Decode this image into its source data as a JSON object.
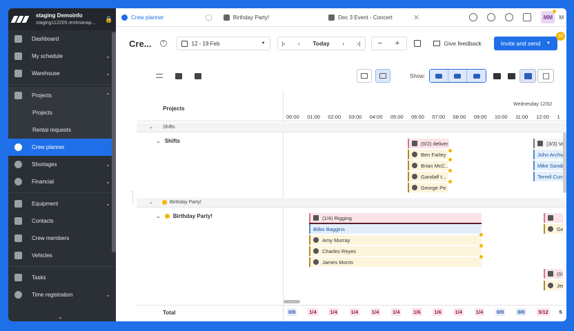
{
  "colors": {
    "brand": "#1f6fe8",
    "sidebar_bg": "#2b2f36",
    "warn": "#f2b705"
  },
  "org": {
    "name": "staging Demoinfo",
    "url": "staging112205.rentmanap..."
  },
  "sidebar": {
    "items": [
      {
        "label": "Dashboard",
        "icon": "grid-icon"
      },
      {
        "label": "My schedule",
        "icon": "calendar-icon"
      },
      {
        "label": "Warehouse",
        "icon": "warehouse-icon"
      },
      {
        "label": "Projects",
        "icon": "projects-icon"
      },
      {
        "label": "Projects",
        "icon": ""
      },
      {
        "label": "Rental requests",
        "icon": ""
      },
      {
        "label": "Crew planner",
        "icon": "person-icon"
      },
      {
        "label": "Shortages",
        "icon": "shortage-icon"
      },
      {
        "label": "Financial",
        "icon": "dollar-icon"
      },
      {
        "label": "Equipment",
        "icon": "equipment-icon"
      },
      {
        "label": "Contacts",
        "icon": "contacts-icon"
      },
      {
        "label": "Crew members",
        "icon": "crew-icon"
      },
      {
        "label": "Vehicles",
        "icon": "truck-icon"
      },
      {
        "label": "Tasks",
        "icon": "tasks-icon"
      },
      {
        "label": "Time registration",
        "icon": "clock-icon"
      }
    ]
  },
  "tabs": [
    {
      "label": "Crew planner"
    },
    {
      "label": "Birthday Party!"
    },
    {
      "label": "Dec 3 Event - Concert"
    }
  ],
  "user": {
    "initials": "MM",
    "name_short": "M"
  },
  "toolbar": {
    "title": "Cre...",
    "date_range": "12 - 19 Feb",
    "today_label": "Today",
    "feedback_label": "Give feedback",
    "invite_label": "Invite and send",
    "notif_count": "28"
  },
  "filters": {
    "show_label": "Show:"
  },
  "grid": {
    "projects_header": "Projects",
    "day_header": "Wednesday 12/02",
    "hours": [
      "00:00",
      "01:00",
      "02:00",
      "03:00",
      "04:00",
      "05:00",
      "06:00",
      "07:00",
      "08:00",
      "09:00",
      "10:00",
      "11:00",
      "12:00",
      "1"
    ],
    "groups": [
      {
        "label": "Shifts",
        "row_label": "Shifts"
      },
      {
        "label": "Birthday Party!",
        "row_label": "Birthday Party!"
      }
    ],
    "shift_cards": [
      {
        "label": "(0/2) deliver",
        "type": "head"
      },
      {
        "label": "Ben Farley",
        "type": "assign"
      },
      {
        "label": "Brian McC...",
        "type": "assign"
      },
      {
        "label": "Gandalf t...",
        "type": "assign"
      },
      {
        "label": "George Pe...",
        "type": "assign"
      }
    ],
    "shift_cards_right": [
      {
        "label": "(3/3) Va",
        "type": "head2"
      },
      {
        "label": "John Archu",
        "type": "person"
      },
      {
        "label": "Mike Sande",
        "type": "person"
      },
      {
        "label": "Terrell Cun",
        "type": "person"
      }
    ],
    "party_cards": [
      {
        "label": "(1/4) Rigging",
        "type": "head"
      },
      {
        "label": "Bilbo Baggins",
        "type": "person"
      },
      {
        "label": "Amy Murray",
        "type": "assign"
      },
      {
        "label": "Charles Reyes",
        "type": "assign"
      },
      {
        "label": "James Morris",
        "type": "assign"
      }
    ],
    "party_cards_right": [
      {
        "label": "",
        "type": "head"
      },
      {
        "label": "Ge",
        "type": "assign"
      },
      {
        "label": "(0/",
        "type": "head"
      },
      {
        "label": "Jer",
        "type": "assign"
      }
    ],
    "total_label": "Total",
    "totals": [
      "0/0",
      "1/4",
      "1/4",
      "1/4",
      "1/4",
      "1/4",
      "1/6",
      "1/6",
      "1/4",
      "1/4",
      "0/0",
      "0/0",
      "5/12",
      "5"
    ]
  }
}
